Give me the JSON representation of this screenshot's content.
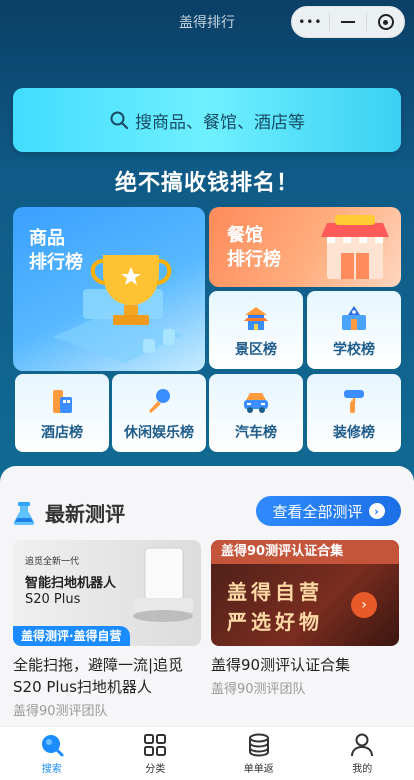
{
  "navbar": {
    "title": "盖得排行"
  },
  "search": {
    "placeholder": "搜商品、餐馆、酒店等"
  },
  "slogan": "绝不搞收钱排名！",
  "big_cards": {
    "product": {
      "line1": "商品",
      "line2": "排行榜"
    },
    "restaurant": {
      "line1": "餐馆",
      "line2": "排行榜"
    }
  },
  "tiles": [
    {
      "label": "景区榜",
      "icon": "scenic-icon"
    },
    {
      "label": "学校榜",
      "icon": "school-icon"
    },
    {
      "label": "酒店榜",
      "icon": "hotel-icon"
    },
    {
      "label": "休闲娱乐榜",
      "icon": "microphone-icon"
    },
    {
      "label": "汽车榜",
      "icon": "car-icon"
    },
    {
      "label": "装修榜",
      "icon": "paint-roller-icon"
    }
  ],
  "reviews_section": {
    "title": "最新测评",
    "view_all": "查看全部测评",
    "items": [
      {
        "img_line1": "追觅全新一代",
        "img_line2": "智能扫地机器人",
        "img_line3": "S20 Plus",
        "img_banner": "盖得测评·盖得自营",
        "title": "全能扫拖，避障一流|追觅S20 Plus扫地机器人",
        "source": "盖得90测评团队"
      },
      {
        "img_header": "盖得90测评认证合集",
        "img_line1": "盖得自营",
        "img_line2": "严选好物",
        "title": "盖得90测评认证合集",
        "source": "盖得90测评团队"
      }
    ]
  },
  "tabbar": [
    {
      "label": "搜索",
      "icon": "search-tab-icon",
      "active": true
    },
    {
      "label": "分类",
      "icon": "grid-icon",
      "active": false
    },
    {
      "label": "单单返",
      "icon": "coins-icon",
      "active": false
    },
    {
      "label": "我的",
      "icon": "user-icon",
      "active": false
    }
  ],
  "colors": {
    "accent": "#1a8cff",
    "header_bg": "#0f5a86",
    "restaurant": "#ff8a5a"
  }
}
